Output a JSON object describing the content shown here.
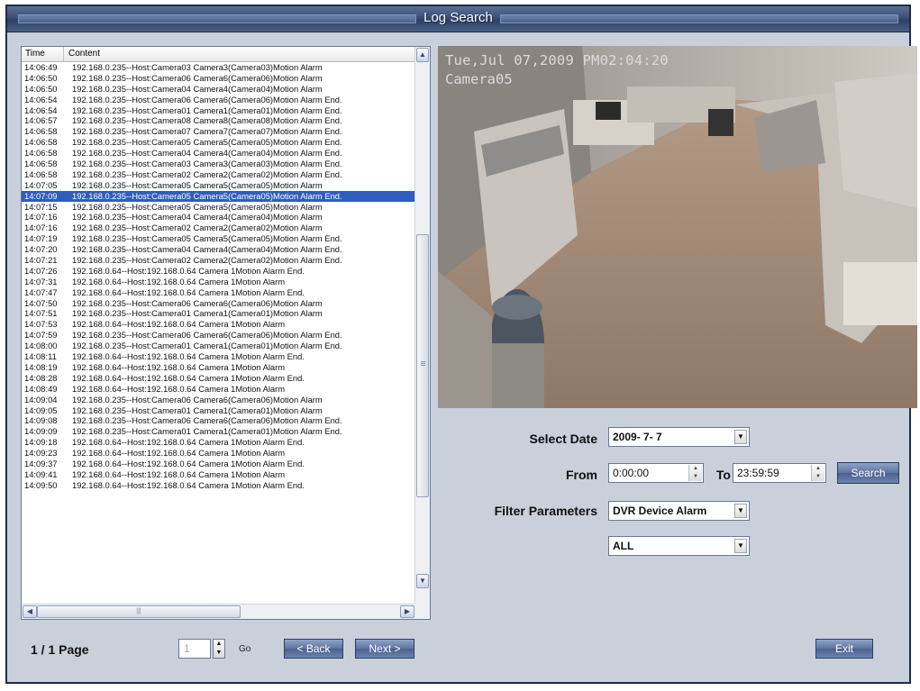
{
  "window": {
    "title": "Log Search"
  },
  "log": {
    "columns": {
      "time": "Time",
      "content": "Content"
    },
    "selected_index": 13,
    "rows": [
      {
        "time": "14:06:49",
        "content": "192.168.0.235--Host:Camera03 Camera3(Camera03)Motion Alarm"
      },
      {
        "time": "14:06:50",
        "content": "192.168.0.235--Host:Camera06 Camera6(Camera06)Motion Alarm"
      },
      {
        "time": "14:06:50",
        "content": "192.168.0.235--Host:Camera04 Camera4(Camera04)Motion Alarm"
      },
      {
        "time": "14:06:54",
        "content": "192.168.0.235--Host:Camera06 Camera6(Camera06)Motion Alarm End."
      },
      {
        "time": "14:06:54",
        "content": "192.168.0.235--Host:Camera01 Camera1(Camera01)Motion Alarm End."
      },
      {
        "time": "14:06:57",
        "content": "192.168.0.235--Host:Camera08 Camera8(Camera08)Motion Alarm End."
      },
      {
        "time": "14:06:58",
        "content": "192.168.0.235--Host:Camera07 Camera7(Camera07)Motion Alarm End."
      },
      {
        "time": "14:06:58",
        "content": "192.168.0.235--Host:Camera05 Camera5(Camera05)Motion Alarm End."
      },
      {
        "time": "14:06:58",
        "content": "192.168.0.235--Host:Camera04 Camera4(Camera04)Motion Alarm End."
      },
      {
        "time": "14:06:58",
        "content": "192.168.0.235--Host:Camera03 Camera3(Camera03)Motion Alarm End."
      },
      {
        "time": "14:06:58",
        "content": "192.168.0.235--Host:Camera02 Camera2(Camera02)Motion Alarm End."
      },
      {
        "time": "14:07:05",
        "content": "192.168.0.235--Host:Camera05 Camera5(Camera05)Motion Alarm"
      },
      {
        "time": "14:07:09",
        "content": "192.168.0.235--Host:Camera05 Camera5(Camera05)Motion Alarm End."
      },
      {
        "time": "14:07:15",
        "content": "192.168.0.235--Host:Camera05 Camera5(Camera05)Motion Alarm"
      },
      {
        "time": "14:07:16",
        "content": "192.168.0.235--Host:Camera04 Camera4(Camera04)Motion Alarm"
      },
      {
        "time": "14:07:16",
        "content": "192.168.0.235--Host:Camera02 Camera2(Camera02)Motion Alarm"
      },
      {
        "time": "14:07:19",
        "content": "192.168.0.235--Host:Camera05 Camera5(Camera05)Motion Alarm End."
      },
      {
        "time": "14:07:20",
        "content": "192.168.0.235--Host:Camera04 Camera4(Camera04)Motion Alarm End."
      },
      {
        "time": "14:07:21",
        "content": "192.168.0.235--Host:Camera02 Camera2(Camera02)Motion Alarm End."
      },
      {
        "time": "14:07:26",
        "content": "192.168.0.64--Host:192.168.0.64 Camera 1Motion Alarm End."
      },
      {
        "time": "14:07:31",
        "content": "192.168.0.64--Host:192.168.0.64 Camera 1Motion Alarm"
      },
      {
        "time": "14:07:47",
        "content": "192.168.0.64--Host:192.168.0.64 Camera 1Motion Alarm End."
      },
      {
        "time": "14:07:50",
        "content": "192.168.0.235--Host:Camera06 Camera6(Camera06)Motion Alarm"
      },
      {
        "time": "14:07:51",
        "content": "192.168.0.235--Host:Camera01 Camera1(Camera01)Motion Alarm"
      },
      {
        "time": "14:07:53",
        "content": "192.168.0.64--Host:192.168.0.64 Camera 1Motion Alarm"
      },
      {
        "time": "14:07:59",
        "content": "192.168.0.235--Host:Camera06 Camera6(Camera06)Motion Alarm End."
      },
      {
        "time": "14:08:00",
        "content": "192.168.0.235--Host:Camera01 Camera1(Camera01)Motion Alarm End."
      },
      {
        "time": "14:08:11",
        "content": "192.168.0.64--Host:192.168.0.64 Camera 1Motion Alarm End."
      },
      {
        "time": "14:08:19",
        "content": "192.168.0.64--Host:192.168.0.64 Camera 1Motion Alarm"
      },
      {
        "time": "14:08:28",
        "content": "192.168.0.64--Host:192.168.0.64 Camera 1Motion Alarm End."
      },
      {
        "time": "14:08:49",
        "content": "192.168.0.64--Host:192.168.0.64 Camera 1Motion Alarm"
      },
      {
        "time": "14:09:04",
        "content": "192.168.0.235--Host:Camera06 Camera6(Camera06)Motion Alarm"
      },
      {
        "time": "14:09:05",
        "content": "192.168.0.235--Host:Camera01 Camera1(Camera01)Motion Alarm"
      },
      {
        "time": "14:09:08",
        "content": "192.168.0.235--Host:Camera06 Camera6(Camera06)Motion Alarm End."
      },
      {
        "time": "14:09:09",
        "content": "192.168.0.235--Host:Camera01 Camera1(Camera01)Motion Alarm End."
      },
      {
        "time": "14:09:18",
        "content": "192.168.0.64--Host:192.168.0.64 Camera 1Motion Alarm End."
      },
      {
        "time": "14:09:23",
        "content": "192.168.0.64--Host:192.168.0.64 Camera 1Motion Alarm"
      },
      {
        "time": "14:09:37",
        "content": "192.168.0.64--Host:192.168.0.64 Camera 1Motion Alarm End."
      },
      {
        "time": "14:09:41",
        "content": "192.168.0.64--Host:192.168.0.64 Camera 1Motion Alarm"
      },
      {
        "time": "14:09:50",
        "content": "192.168.0.64--Host:192.168.0.64 Camera 1Motion Alarm End."
      }
    ]
  },
  "pager": {
    "page_label": "1 / 1 Page",
    "page_input": "1",
    "go_label": "Go",
    "back_label": "< Back",
    "next_label": "Next >"
  },
  "camera": {
    "osd_datetime": "Tue,Jul 07,2009 PM02:04:20",
    "osd_name": "Camera05"
  },
  "form": {
    "select_date_label": "Select Date",
    "select_date_value": "2009- 7- 7",
    "from_label": "From",
    "from_value": "0:00:00",
    "to_label": "To",
    "to_value": "23:59:59",
    "search_label": "Search",
    "filter_label": "Filter Parameters",
    "filter_type_value": "DVR Device Alarm",
    "filter_scope_value": "ALL",
    "exit_label": "Exit"
  },
  "icons": {
    "scroll_up": "scroll-up-arrow-icon",
    "scroll_down": "scroll-down-arrow-icon",
    "scroll_left": "scroll-left-arrow-icon",
    "scroll_right": "scroll-right-arrow-icon",
    "dropdown": "chevron-down-icon",
    "spinner": "spinner-arrows-icon"
  },
  "colors": {
    "title_bar": "#3b4f76",
    "window_bg": "#c9d0dc",
    "selection": "#2f5cc0",
    "button": "#5c749f"
  }
}
